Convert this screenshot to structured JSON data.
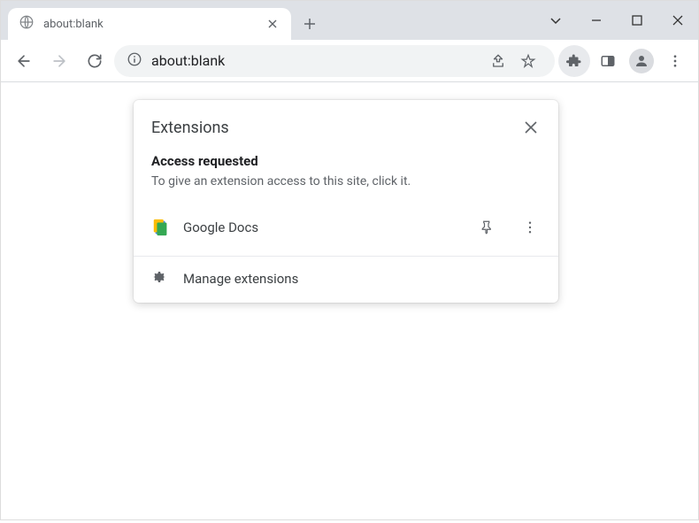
{
  "tab": {
    "title": "about:blank"
  },
  "omnibox": {
    "url": "about:blank"
  },
  "popup": {
    "title": "Extensions",
    "section_heading": "Access requested",
    "section_desc": "To give an extension access to this site, click it.",
    "extensions": [
      {
        "name": "Google Docs"
      }
    ],
    "manage_label": "Manage extensions"
  }
}
